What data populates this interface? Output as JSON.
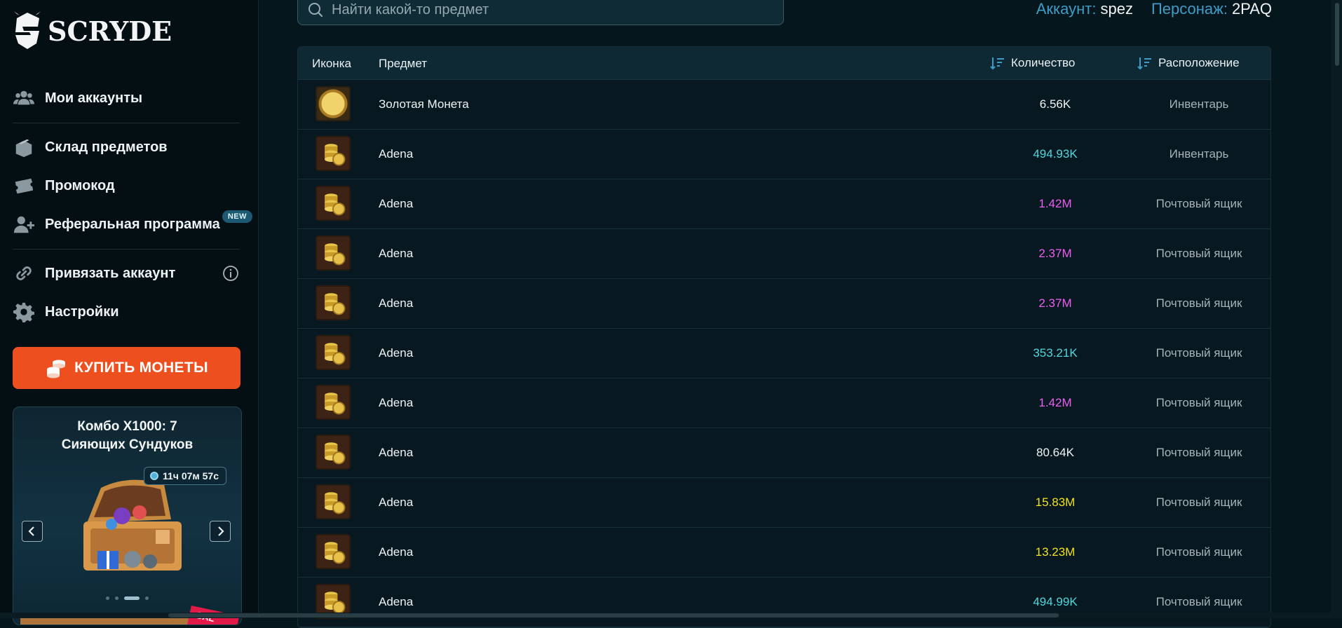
{
  "brand": {
    "name": "SCRYDE"
  },
  "sidebar": {
    "items": [
      {
        "label": "Мои аккаунты",
        "icon": "users-icon"
      },
      {
        "label": "Склад предметов",
        "icon": "warehouse-icon"
      },
      {
        "label": "Промокод",
        "icon": "ticket-icon"
      },
      {
        "label": "Реферальная программа",
        "icon": "add-user-icon",
        "badge": "NEW"
      },
      {
        "label": "Привязать аккаунт",
        "icon": "link-icon"
      },
      {
        "label": "Настройки",
        "icon": "gear-icon"
      }
    ],
    "buy_button": "КУПИТЬ МОНЕТЫ",
    "promo": {
      "title_line1": "Комбо X1000: 7",
      "title_line2": "Сияющих Сундуков",
      "timer": "11ч 07м 57с",
      "tag": "SAL"
    }
  },
  "header": {
    "search_placeholder": "Найти какой-то предмет",
    "account_label": "Аккаунт:",
    "account_value": "spez",
    "character_label": "Персонаж:",
    "character_value": "2PAQ"
  },
  "table": {
    "columns": {
      "icon": "Иконка",
      "item": "Предмет",
      "quantity": "Количество",
      "location": "Расположение"
    },
    "rows": [
      {
        "icon": "gold-coin",
        "name": "Золотая Монета",
        "qty": "6.56K",
        "qty_color": "#f1f4f5",
        "loc": "Инвентарь"
      },
      {
        "icon": "adena",
        "name": "Adena",
        "qty": "494.93K",
        "qty_color": "#4fd9df",
        "loc": "Инвентарь"
      },
      {
        "icon": "adena",
        "name": "Adena",
        "qty": "1.42M",
        "qty_color": "#ec5ef0",
        "loc": "Почтовый ящик"
      },
      {
        "icon": "adena",
        "name": "Adena",
        "qty": "2.37M",
        "qty_color": "#ec5ef0",
        "loc": "Почтовый ящик"
      },
      {
        "icon": "adena",
        "name": "Adena",
        "qty": "2.37M",
        "qty_color": "#ec5ef0",
        "loc": "Почтовый ящик"
      },
      {
        "icon": "adena",
        "name": "Adena",
        "qty": "353.21K",
        "qty_color": "#4fd9df",
        "loc": "Почтовый ящик"
      },
      {
        "icon": "adena",
        "name": "Adena",
        "qty": "1.42M",
        "qty_color": "#ec5ef0",
        "loc": "Почтовый ящик"
      },
      {
        "icon": "adena",
        "name": "Adena",
        "qty": "80.64K",
        "qty_color": "#f1f4f5",
        "loc": "Почтовый ящик"
      },
      {
        "icon": "adena",
        "name": "Adena",
        "qty": "15.83M",
        "qty_color": "#f2e21c",
        "loc": "Почтовый ящик"
      },
      {
        "icon": "adena",
        "name": "Adena",
        "qty": "13.23M",
        "qty_color": "#f2e21c",
        "loc": "Почтовый ящик"
      },
      {
        "icon": "adena",
        "name": "Adena",
        "qty": "494.99K",
        "qty_color": "#4fd9df",
        "loc": "Почтовый ящик"
      }
    ]
  },
  "colors": {
    "accent": "#3f9cc6",
    "buy_button": "#ee4f1f",
    "badge": "#1b5a72"
  }
}
